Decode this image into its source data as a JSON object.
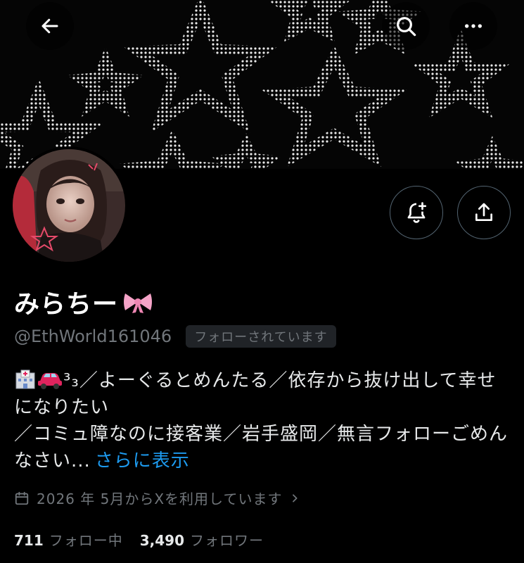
{
  "header": {
    "back_icon": "arrow-left-icon",
    "search_icon": "search-icon",
    "more_icon": "more-horizontal-icon"
  },
  "profile": {
    "display_name": "みらちー",
    "name_emoji": "ribbon-icon",
    "handle": "@EthWorld161046",
    "follows_you_badge": "フォローされています",
    "bio_line1": "³₃／よーぐるとめんたる／依存から抜け出して幸せになりたい",
    "bio_line2": "／コミュ障なのに接客業／岩手盛岡／無言フォローごめんなさい...",
    "bio_more": "さらに表示",
    "bio_emojis": [
      "hospital-icon",
      "car-icon"
    ],
    "joined": "2026 年 5月からXを利用しています",
    "following_count": "711",
    "following_label": "フォロー中",
    "followers_count": "3,490",
    "followers_label": "フォロワー"
  },
  "actions": {
    "notify_icon": "bell-plus-icon",
    "share_icon": "share-icon"
  },
  "colors": {
    "background": "#000000",
    "primary_text": "#e7e9ea",
    "secondary_text": "#71767b",
    "link": "#1d9bf0",
    "border": "#536471"
  }
}
